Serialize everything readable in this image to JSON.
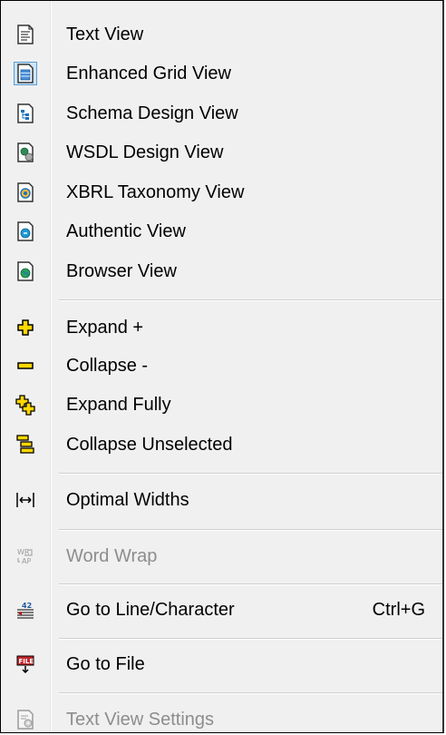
{
  "menu": {
    "items": [
      {
        "label": "Text View",
        "icon": "text-view-icon",
        "enabled": true
      },
      {
        "label": "Enhanced Grid View",
        "icon": "grid-view-icon",
        "enabled": true,
        "checked": true
      },
      {
        "label": "Schema Design View",
        "icon": "schema-view-icon",
        "enabled": true
      },
      {
        "label": "WSDL Design View",
        "icon": "wsdl-view-icon",
        "enabled": true
      },
      {
        "label": "XBRL Taxonomy View",
        "icon": "xbrl-view-icon",
        "enabled": true
      },
      {
        "label": "Authentic View",
        "icon": "authentic-view-icon",
        "enabled": true
      },
      {
        "label": "Browser View",
        "icon": "browser-view-icon",
        "enabled": true
      },
      {
        "label": "Expand +",
        "icon": "expand-icon",
        "enabled": true
      },
      {
        "label": "Collapse -",
        "icon": "collapse-icon",
        "enabled": true
      },
      {
        "label": "Expand Fully",
        "icon": "expand-fully-icon",
        "enabled": true
      },
      {
        "label": "Collapse Unselected",
        "icon": "collapse-unselected-icon",
        "enabled": true
      },
      {
        "label": "Optimal Widths",
        "icon": "optimal-widths-icon",
        "enabled": true
      },
      {
        "label": "Word Wrap",
        "icon": "word-wrap-icon",
        "enabled": false
      },
      {
        "label": "Go to Line/Character",
        "icon": "goto-line-icon",
        "enabled": true,
        "shortcut": "Ctrl+G"
      },
      {
        "label": "Go to File",
        "icon": "goto-file-icon",
        "enabled": true
      },
      {
        "label": "Text View Settings",
        "icon": "text-view-settings-icon",
        "enabled": false
      }
    ]
  },
  "colors": {
    "menu_bg": "#f0f0f0",
    "disabled_text": "#8d8d8d",
    "icon_yellow": "#ffd800",
    "icon_blue": "#1e73be"
  }
}
